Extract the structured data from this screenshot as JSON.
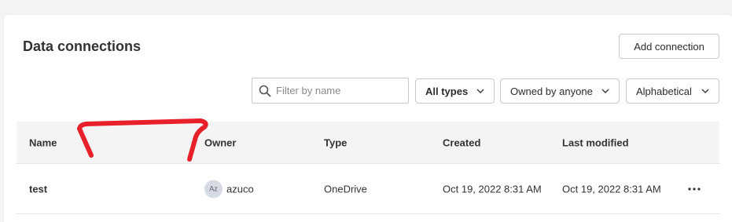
{
  "header": {
    "title": "Data connections",
    "add_button_label": "Add connection"
  },
  "filters": {
    "search_placeholder": "Filter by name",
    "type_filter": "All types",
    "owner_filter": "Owned by anyone",
    "sort": "Alphabetical"
  },
  "table": {
    "columns": [
      "Name",
      "Owner",
      "Type",
      "Created",
      "Last modified"
    ],
    "rows": [
      {
        "name": "test",
        "owner_initials": "Az",
        "owner": "azuco",
        "type": "OneDrive",
        "created": "Oct 19, 2022 8:31 AM",
        "last_modified": "Oct 19, 2022 8:31 AM"
      }
    ]
  },
  "colors": {
    "annotation_stroke": "#e8202a",
    "header_bg": "#f4f4f4",
    "avatar_bg": "#d5dae3"
  },
  "icons": [
    "search-icon",
    "chevron-down-icon",
    "more-options-icon"
  ]
}
